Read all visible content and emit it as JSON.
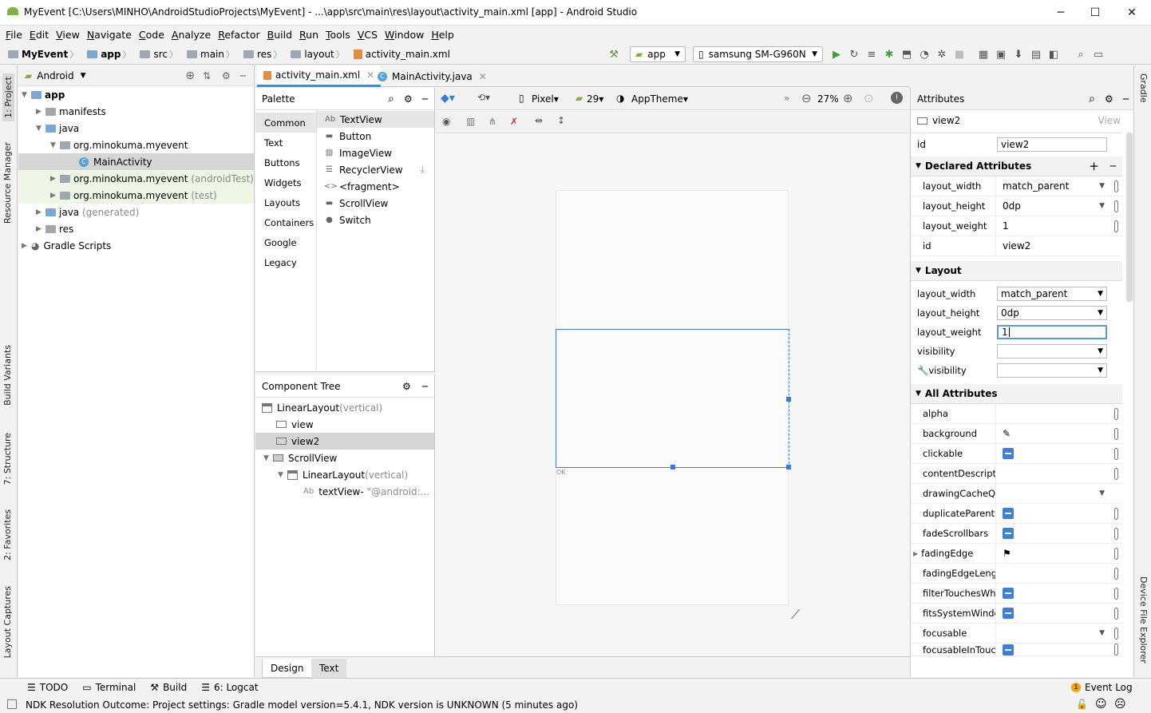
{
  "window": {
    "title": "MyEvent [C:\\Users\\MINHO\\AndroidStudioProjects\\MyEvent] - ...\\app\\src\\main\\res\\layout\\activity_main.xml [app] - Android Studio"
  },
  "menu": [
    "File",
    "Edit",
    "View",
    "Navigate",
    "Code",
    "Analyze",
    "Refactor",
    "Build",
    "Run",
    "Tools",
    "VCS",
    "Window",
    "Help"
  ],
  "breadcrumb": [
    "MyEvent",
    "app",
    "src",
    "main",
    "res",
    "layout",
    "activity_main.xml"
  ],
  "toolbar": {
    "config": "app",
    "device": "samsung SM-G960N"
  },
  "left_tabs": [
    "1: Project",
    "Resource Manager",
    "Build Variants",
    "7: Structure",
    "2: Favorites",
    "Layout Captures"
  ],
  "right_tabs": [
    "Gradle",
    "Device File Explorer"
  ],
  "project": {
    "view": "Android",
    "tree": [
      {
        "label": "app",
        "sub": ""
      },
      {
        "label": "manifests",
        "sub": ""
      },
      {
        "label": "java",
        "sub": ""
      },
      {
        "label": "org.minokuma.myevent",
        "sub": ""
      },
      {
        "label": "MainActivity",
        "sub": ""
      },
      {
        "label": "org.minokuma.myevent",
        "sub": "(androidTest)"
      },
      {
        "label": "org.minokuma.myevent",
        "sub": "(test)"
      },
      {
        "label": "java",
        "sub": "(generated)"
      },
      {
        "label": "res",
        "sub": ""
      },
      {
        "label": "Gradle Scripts",
        "sub": ""
      }
    ]
  },
  "tabs": [
    "activity_main.xml",
    "MainActivity.java"
  ],
  "palette": {
    "title": "Palette",
    "categories": [
      "Common",
      "Text",
      "Buttons",
      "Widgets",
      "Layouts",
      "Containers",
      "Google",
      "Legacy"
    ],
    "items": [
      "TextView",
      "Button",
      "ImageView",
      "RecyclerView",
      "<fragment>",
      "ScrollView",
      "Switch"
    ]
  },
  "component_tree": {
    "title": "Component Tree",
    "rows": [
      {
        "label": "LinearLayout",
        "sub": "(vertical)"
      },
      {
        "label": "view",
        "sub": ""
      },
      {
        "label": "view2",
        "sub": ""
      },
      {
        "label": "ScrollView",
        "sub": ""
      },
      {
        "label": "LinearLayout",
        "sub": "(vertical)"
      },
      {
        "label": "textView-",
        "sub": "\"@android:..."
      }
    ]
  },
  "designer": {
    "device": "Pixel",
    "api": "29",
    "theme": "AppTheme",
    "zoom": "27%",
    "ok_label": "OK"
  },
  "bottom_tabs": [
    "Design",
    "Text"
  ],
  "attributes": {
    "title": "Attributes",
    "selected": "view2",
    "view_link": "View",
    "id_label": "id",
    "id_value": "view2",
    "declared_title": "Declared Attributes",
    "declared": [
      {
        "name": "layout_width",
        "value": "match_parent"
      },
      {
        "name": "layout_height",
        "value": "0dp"
      },
      {
        "name": "layout_weight",
        "value": "1"
      },
      {
        "name": "id",
        "value": "view2"
      }
    ],
    "layout_title": "Layout",
    "layout": [
      {
        "name": "layout_width",
        "value": "match_parent"
      },
      {
        "name": "layout_height",
        "value": "0dp"
      },
      {
        "name": "layout_weight",
        "value": "1"
      },
      {
        "name": "visibility",
        "value": ""
      },
      {
        "name": "visibility",
        "value": ""
      }
    ],
    "all_title": "All Attributes",
    "all": [
      "alpha",
      "background",
      "clickable",
      "contentDescriptio",
      "drawingCacheQua",
      "duplicateParentSt",
      "fadeScrollbars",
      "fadingEdge",
      "fadingEdgeLength",
      "filterTouchesWhen",
      "fitsSystemWindow",
      "focusable",
      "focusableInTouchI"
    ]
  },
  "status": {
    "tools": [
      "TODO",
      "Terminal",
      "Build",
      "6: Logcat"
    ],
    "event_log": "Event Log",
    "event_count": "1",
    "message": "NDK Resolution Outcome: Project settings: Gradle model version=5.4.1, NDK version is UNKNOWN (5 minutes ago)"
  }
}
